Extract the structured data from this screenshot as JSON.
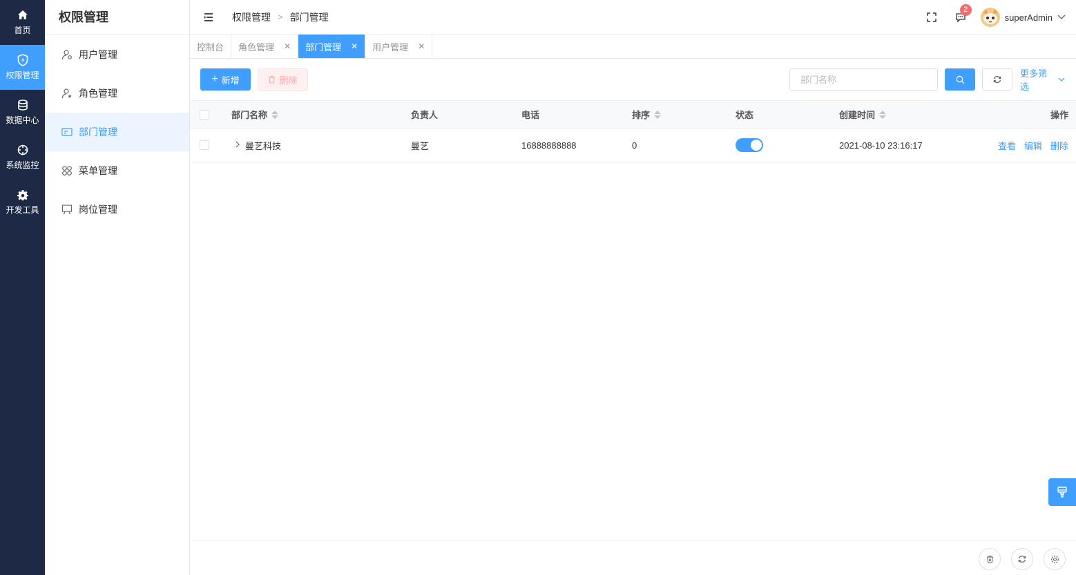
{
  "rail": {
    "items": [
      {
        "label": "首页",
        "icon": "home-icon"
      },
      {
        "label": "权限管理",
        "icon": "shield-icon"
      },
      {
        "label": "数据中心",
        "icon": "database-icon"
      },
      {
        "label": "系统监控",
        "icon": "monitor-icon"
      },
      {
        "label": "开发工具",
        "icon": "gear-icon"
      }
    ],
    "active_index": 1
  },
  "submenu": {
    "title": "权限管理",
    "items": [
      {
        "label": "用户管理",
        "icon": "user-settings-icon"
      },
      {
        "label": "角色管理",
        "icon": "user-star-icon"
      },
      {
        "label": "部门管理",
        "icon": "id-card-icon"
      },
      {
        "label": "菜单管理",
        "icon": "grid-icon"
      },
      {
        "label": "岗位管理",
        "icon": "easel-icon"
      }
    ],
    "active_index": 2
  },
  "header": {
    "breadcrumb": [
      "权限管理",
      "部门管理"
    ],
    "message_count": "2",
    "username": "superAdmin"
  },
  "tabs": [
    {
      "label": "控制台",
      "closable": false
    },
    {
      "label": "角色管理",
      "closable": true
    },
    {
      "label": "部门管理",
      "closable": true,
      "active": true
    },
    {
      "label": "用户管理",
      "closable": true
    }
  ],
  "toolbar": {
    "add_label": "新增",
    "delete_label": "删除",
    "search_placeholder": "部门名称",
    "more_filter_label": "更多筛选"
  },
  "table": {
    "columns": [
      "部门名称",
      "负责人",
      "电话",
      "排序",
      "状态",
      "创建时间",
      "操作"
    ],
    "rows": [
      {
        "name": "曼艺科技",
        "leader": "曼艺",
        "phone": "16888888888",
        "sort": "0",
        "status_on": true,
        "created": "2021-08-10 23:16:17",
        "actions": [
          "查看",
          "编辑",
          "删除"
        ]
      }
    ]
  },
  "colors": {
    "accent": "#409eff",
    "rail_bg": "#1e2a45",
    "danger": "#f56c6c"
  }
}
